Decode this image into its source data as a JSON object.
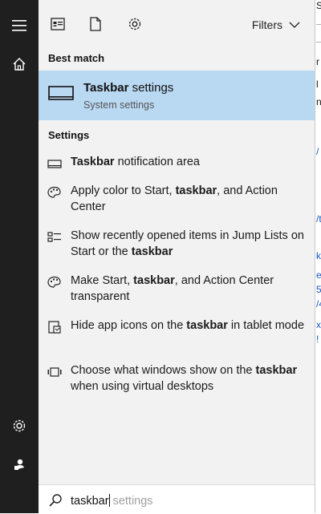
{
  "toolbar": {
    "filters_label": "Filters",
    "buttons": [
      "apps-icon",
      "documents-icon",
      "settings-icon"
    ]
  },
  "best_match": {
    "header": "Best match",
    "title_bold": "Taskbar",
    "title_rest": " settings",
    "subtitle": "System settings",
    "icon": "taskbar-icon"
  },
  "settings_section": {
    "header": "Settings",
    "items": [
      {
        "icon": "taskbar-icon",
        "pre": "",
        "bold": "Taskbar",
        "post": " notification area"
      },
      {
        "icon": "palette-icon",
        "pre": "Apply color to Start, ",
        "bold": "taskbar",
        "post": ", and Action Center"
      },
      {
        "icon": "jumplist-icon",
        "pre": "Show recently opened items in Jump Lists on Start or the ",
        "bold": "taskbar",
        "post": ""
      },
      {
        "icon": "palette-icon",
        "pre": "Make Start, ",
        "bold": "taskbar",
        "post": ", and Action Center transparent"
      },
      {
        "icon": "tablet-icon",
        "pre": "Hide app icons on the ",
        "bold": "taskbar",
        "post": " in tablet mode"
      },
      {
        "icon": "virtual-desktop-icon",
        "pre": "Choose what windows show on the ",
        "bold": "taskbar",
        "post": " when using virtual desktops"
      }
    ]
  },
  "search": {
    "typed": "taskbar",
    "suggestion": " settings"
  },
  "rail": {
    "top_buttons": [
      "hamburger-menu-icon",
      "home-icon"
    ],
    "bottom_buttons": [
      "settings-icon",
      "user-icon"
    ]
  },
  "background_window": {
    "fragments": [
      "S",
      "r",
      "l",
      "n",
      "/",
      "/t",
      "k/",
      "e",
      "5",
      "/4",
      "x",
      "!"
    ]
  },
  "colors": {
    "rail": "#1f1f1f",
    "panel": "#f2f2f2",
    "selection": "#b9d8f2",
    "link": "#1a56b8"
  }
}
